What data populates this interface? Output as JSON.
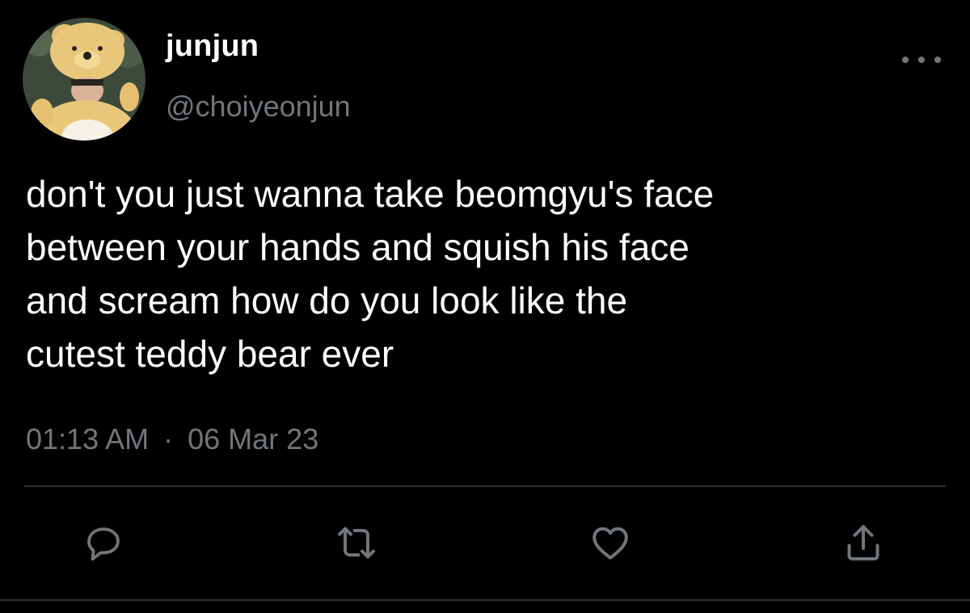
{
  "tweet": {
    "display_name": "junjun",
    "handle": "@choiyeonjun",
    "text": "don't you just wanna take beomgyu's face\nbetween your hands and squish his face\nand scream how do you look like the\ncutest teddy bear ever",
    "time": "01:13 AM",
    "separator": "·",
    "date": "06 Mar 23"
  },
  "actions": {
    "icons": [
      "reply-icon",
      "retweet-icon",
      "like-icon",
      "share-icon"
    ]
  },
  "colors": {
    "background": "#000000",
    "primary_text": "#ffffff",
    "secondary_text": "#71767b",
    "divider": "#2f3336",
    "avatar_costume": "#e9c77a"
  }
}
